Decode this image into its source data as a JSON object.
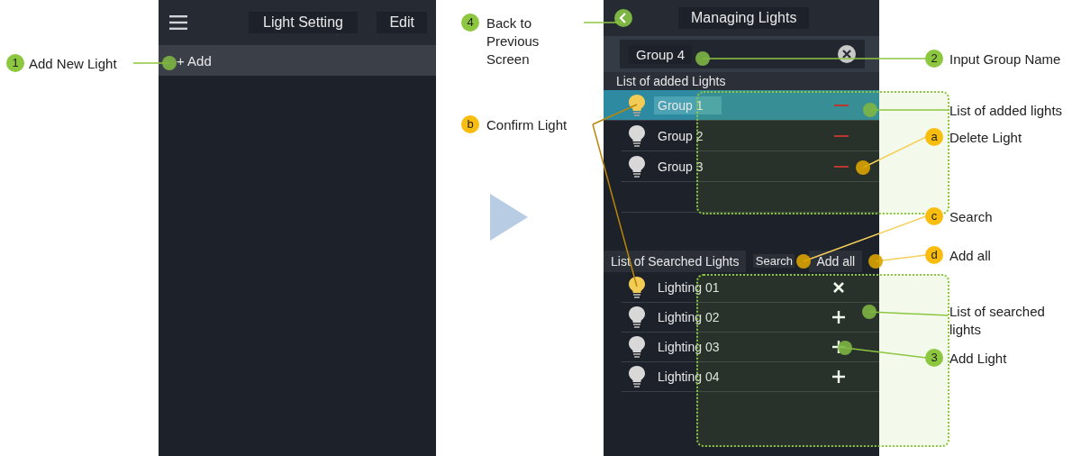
{
  "screen_1": {
    "title": "Light Setting",
    "edit_button": "Edit",
    "add_button": "+ Add"
  },
  "screen_2": {
    "title": "Managing Lights",
    "group_name": "Group 4",
    "added_header": "List of added Lights",
    "added_lights": [
      {
        "name": "Group 1",
        "selected": true,
        "lit": true
      },
      {
        "name": "Group 2",
        "selected": false,
        "lit": false
      },
      {
        "name": "Group 3",
        "selected": false,
        "lit": false
      }
    ],
    "searched_header": "List of Searched Lights",
    "search_button": "Search",
    "add_all_button": "Add all",
    "searched_lights": [
      {
        "name": "Lighting 01",
        "lit": true,
        "kind": "remove"
      },
      {
        "name": "Lighting 02",
        "lit": false,
        "kind": "add"
      },
      {
        "name": "Lighting 03",
        "lit": false,
        "kind": "add"
      },
      {
        "name": "Lighting 04",
        "lit": false,
        "kind": "add"
      }
    ]
  },
  "annotations": [
    {
      "marker": "1",
      "kind": "step",
      "text": "Add New Light"
    },
    {
      "marker": "4",
      "kind": "step",
      "text": "Back to Previous Screen"
    },
    {
      "marker": "b",
      "kind": "action",
      "text": "Confirm Light"
    },
    {
      "marker": "2",
      "kind": "step",
      "text": "Input Group Name"
    },
    {
      "kind": "region",
      "text": "List of added lights"
    },
    {
      "marker": "a",
      "kind": "action",
      "text": "Delete Light"
    },
    {
      "marker": "c",
      "kind": "action",
      "text": "Search"
    },
    {
      "marker": "d",
      "kind": "action",
      "text": "Add all"
    },
    {
      "kind": "region",
      "text": "List of searched lights"
    },
    {
      "marker": "3",
      "kind": "step",
      "text": "Add Light"
    }
  ]
}
